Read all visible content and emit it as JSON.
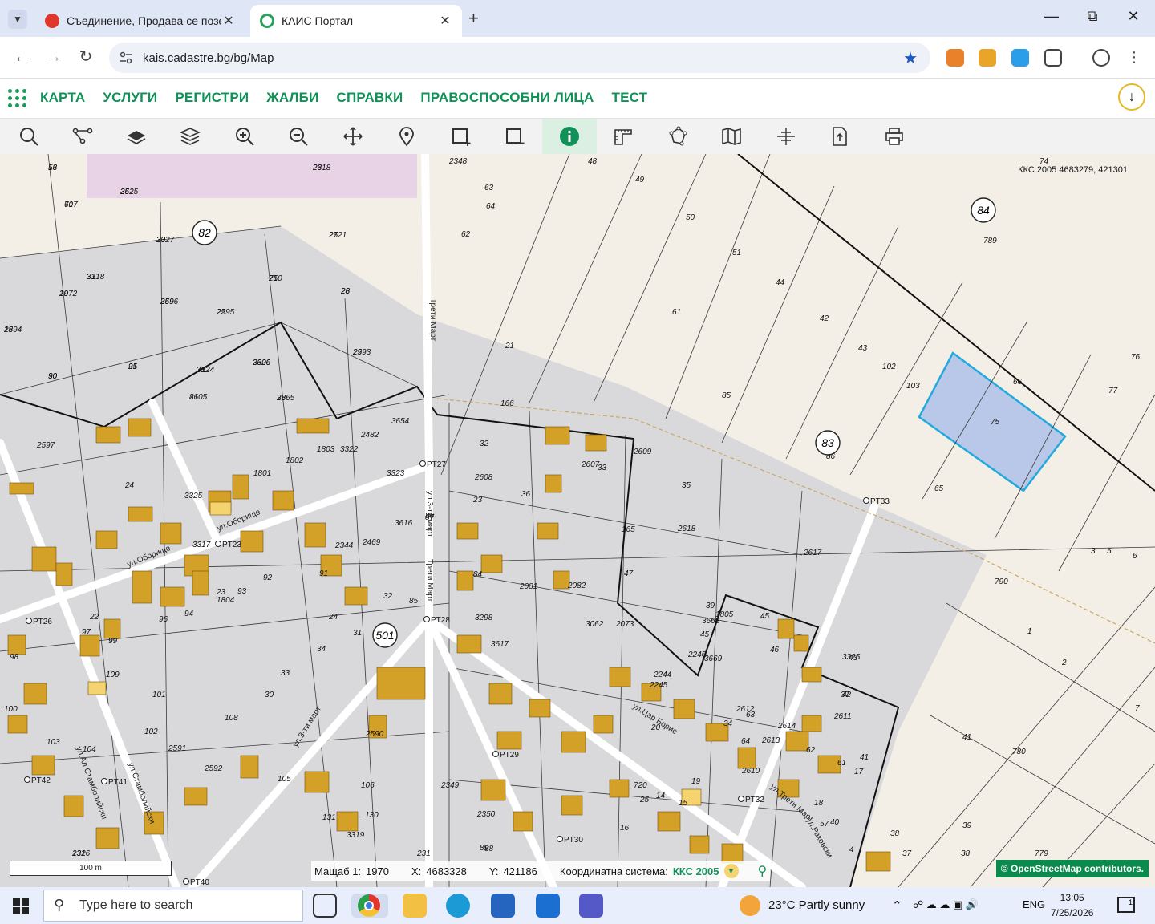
{
  "browser": {
    "tabs": [
      {
        "title": "Съединение, Продава се позе",
        "favicon_color": "#e0352b"
      },
      {
        "title": "КАИС Портал",
        "favicon_color": "#2aa05a"
      }
    ],
    "url": "kais.cadastre.bg/bg/Map"
  },
  "app": {
    "menu": [
      "КАРТА",
      "УСЛУГИ",
      "РЕГИСТРИ",
      "ЖАЛБИ",
      "СПРАВКИ",
      "ПРАВОСПОСОБНИ ЛИЦА",
      "ТЕСТ"
    ],
    "tools": [
      "search-icon",
      "route-icon",
      "layer-icon",
      "layers-icon",
      "zoom-in-icon",
      "zoom-out-icon",
      "pan-icon",
      "marker-icon",
      "draw-rect-icon",
      "clear-rect-icon",
      "info-icon",
      "measure-icon",
      "polygon-icon",
      "map-icon",
      "crosshair-icon",
      "export-icon",
      "print-icon"
    ],
    "active_tool": "info-icon",
    "accent": "#119158"
  },
  "map": {
    "coord_label": "ККС 2005 4683279, 421301",
    "scale_label": "100 m",
    "status": {
      "scale_label": "Мащаб 1:",
      "scale_value": "1970",
      "x_label": "X:",
      "x_value": "4683328",
      "y_label": "Y:",
      "y_value": "421186",
      "system_label": "Координатна система:",
      "system_value": "ККС 2005"
    },
    "attribution": "© OpenStreetMap contributors.",
    "circle_labels": [
      "82",
      "84",
      "83",
      "501"
    ],
    "parcel_labels": [
      "13",
      "26",
      "352",
      "717",
      "20",
      "27",
      "31",
      "19",
      "710",
      "28",
      "369",
      "22",
      "18",
      "29",
      "21",
      "30",
      "712",
      "2606",
      "2605",
      "28",
      "2482",
      "3654",
      "1803",
      "3322",
      "2597",
      "1802",
      "1801",
      "3323",
      "24",
      "3325",
      "23",
      "32",
      "2608",
      "2607",
      "33",
      "2609",
      "35",
      "36",
      "3616",
      "2469",
      "2344",
      "91",
      "92",
      "1804",
      "93",
      "94",
      "96",
      "97",
      "99",
      "98",
      "109",
      "100",
      "101",
      "108",
      "102",
      "2591",
      "2592",
      "103",
      "104",
      "105",
      "106",
      "3319",
      "130",
      "131",
      "132",
      "2590",
      "2349",
      "2350",
      "2348",
      "89",
      "88",
      "87",
      "86",
      "85",
      "84",
      "2081",
      "2082",
      "3298",
      "3617",
      "3062",
      "2073",
      "2245",
      "2244",
      "2246",
      "34",
      "2610",
      "2612",
      "64",
      "63",
      "2613",
      "2614",
      "62",
      "61",
      "37",
      "2611",
      "40",
      "4",
      "41",
      "42",
      "43",
      "3325",
      "45",
      "46",
      "1805",
      "3668",
      "3669",
      "2618",
      "2617",
      "166",
      "165",
      "47",
      "45",
      "39",
      "38",
      "41",
      "37",
      "38",
      "39",
      "779",
      "780",
      "1",
      "790",
      "2",
      "3",
      "5",
      "6",
      "7",
      "65",
      "66",
      "75",
      "76",
      "77",
      "74",
      "789",
      "61",
      "62",
      "63",
      "64",
      "48",
      "49",
      "50",
      "51",
      "44",
      "42",
      "43",
      "102",
      "103",
      "85",
      "86",
      "720",
      "25",
      "14",
      "15",
      "16",
      "17",
      "18",
      "19",
      "20",
      "21",
      "22",
      "23",
      "24",
      "30",
      "31",
      "32",
      "33",
      "34",
      "2316",
      "231",
      "3317",
      "57",
      "56",
      "2318",
      "2615",
      "60",
      "3327",
      "2621",
      "3318",
      "2072",
      "25",
      "26",
      "2596",
      "2595",
      "2594",
      "2593",
      "95",
      "90",
      "3324",
      "3320",
      "81",
      "3665"
    ],
    "street_labels": [
      "Трети Март",
      "ул.Оборище",
      "ул.Оборище",
      "ул.3-ти март",
      "Трети Март",
      "ул.3-ти март",
      "ул.Цар Борис",
      "ул.Трети Март",
      "ул.Ал.Стамболийски",
      "ул.Стамболийски",
      "ул.Раковски"
    ],
    "point_labels": [
      "PT27",
      "PT23",
      "PT26",
      "PT28",
      "PT29",
      "PT30",
      "PT33",
      "PT32",
      "PT41",
      "PT42",
      "PT40"
    ]
  },
  "taskbar": {
    "search_placeholder": "Type here to search",
    "weather": "23°C  Partly sunny",
    "lang": "ENG",
    "time": "13:05",
    "date": "7/25/2026",
    "notification_count": "1"
  }
}
